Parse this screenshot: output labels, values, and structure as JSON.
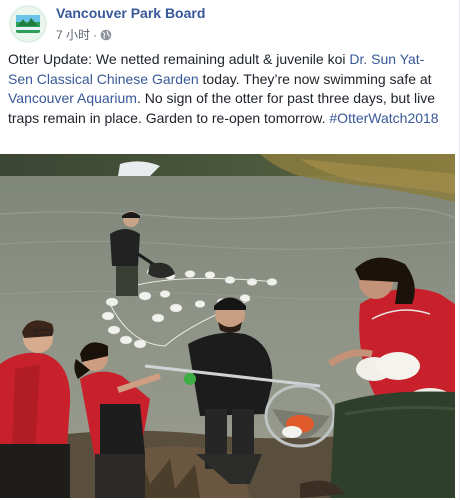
{
  "post": {
    "page_name": "Vancouver Park Board",
    "timestamp": "7 小时",
    "separator": "·",
    "privacy_icon": "globe-icon",
    "text": {
      "intro": "Otter Update: We netted remaining adult & juvenile koi ",
      "link_garden": "Dr. Sun Yat-Sen Classical Chinese Garden",
      "mid1": " today. They’re now swimming safe at ",
      "link_aquarium": "Vancouver Aquarium",
      "mid2": ". No sign of the otter for past three days, but live traps remain in place. Garden to re-open tomorrow. ",
      "hashtag": "#OtterWatch2018"
    }
  },
  "colors": {
    "link": "#385898",
    "text": "#1d2129",
    "meta": "#606770",
    "jacket_red": "#c8212b"
  },
  "photo": {
    "subject": "staff netting koi from pond"
  }
}
